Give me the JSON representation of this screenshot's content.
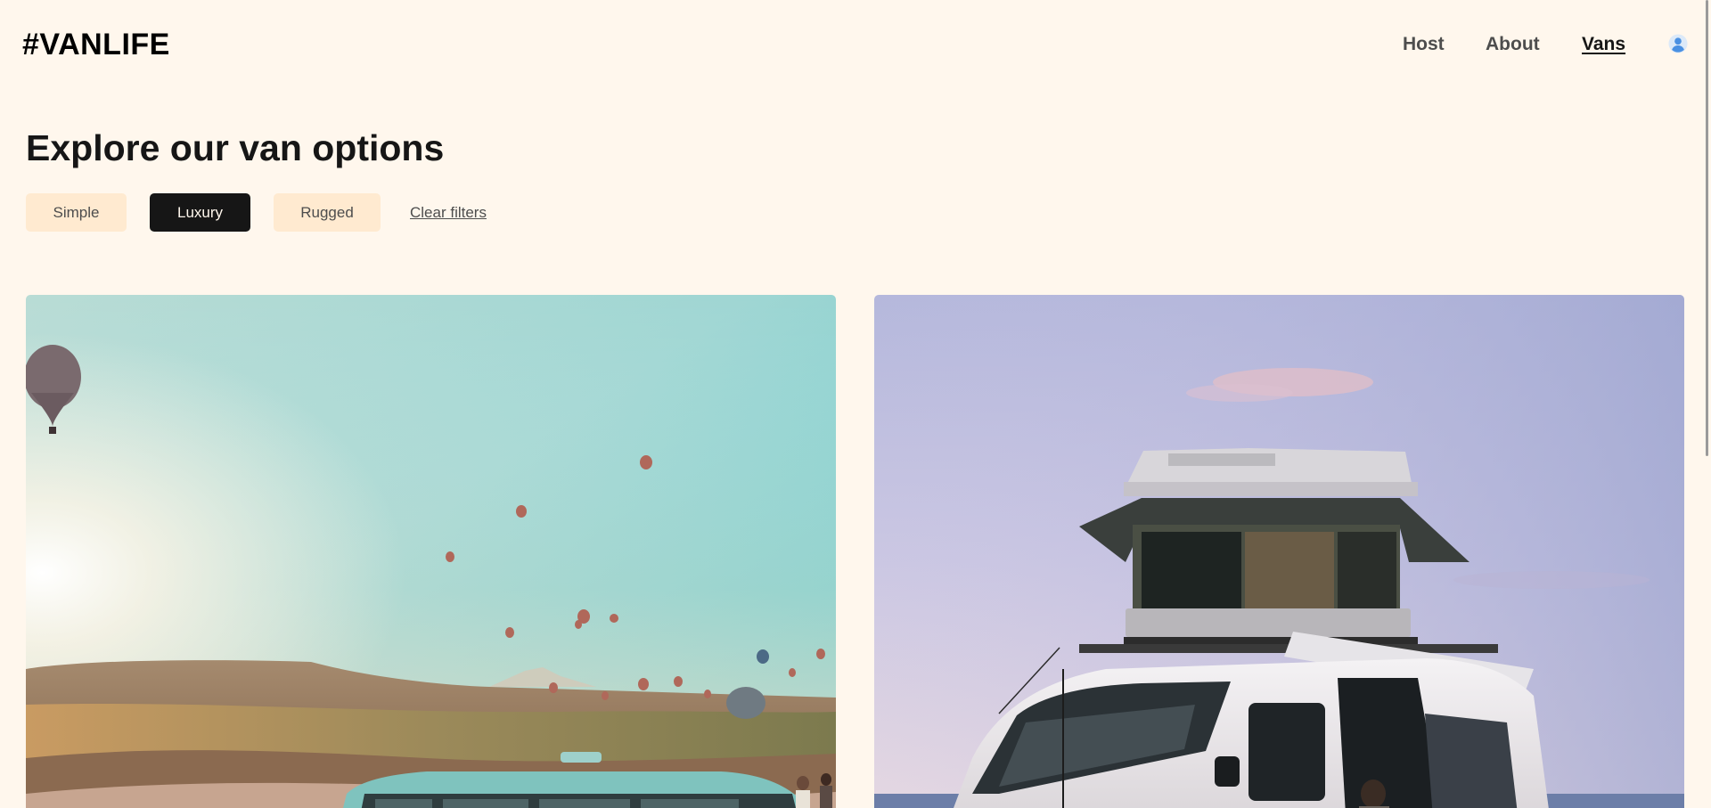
{
  "header": {
    "logo": "#VANLIFE",
    "nav": [
      {
        "label": "Host",
        "active": false
      },
      {
        "label": "About",
        "active": false
      },
      {
        "label": "Vans",
        "active": true
      }
    ],
    "user_icon": "user-circle-icon"
  },
  "main": {
    "title": "Explore our van options",
    "filters": [
      {
        "label": "Simple",
        "selected": false
      },
      {
        "label": "Luxury",
        "selected": true
      },
      {
        "label": "Rugged",
        "selected": false
      }
    ],
    "clear_filters_label": "Clear filters"
  },
  "vans": [
    {
      "image_subject": "vintage-van-hot-air-balloons"
    },
    {
      "image_subject": "white-van-rooftop-tent"
    }
  ],
  "colors": {
    "background": "#FFF7ED",
    "filter_bg": "#FFEAD0",
    "filter_selected_bg": "#161616",
    "text_dark": "#161616",
    "text_muted": "#4D4D4D",
    "user_icon": "#4A90E2"
  }
}
